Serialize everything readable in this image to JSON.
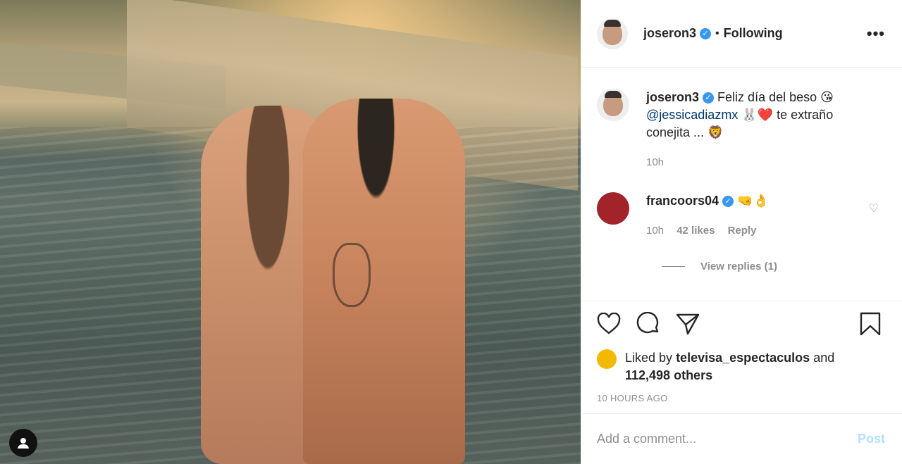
{
  "post": {
    "username": "joseron3",
    "separator": "•",
    "follow_status": "Following",
    "more_icon": "more-options-icon"
  },
  "caption": {
    "username": "joseron3",
    "text_part1": "Feliz día del beso 😘",
    "mention": "@jessicadiazmx",
    "text_part2": "🐰❤️ te extraño conejita ... 🦁",
    "time": "10h"
  },
  "comments": [
    {
      "username": "francoors04",
      "text": "🤜👌",
      "time": "10h",
      "likes": "42 likes",
      "reply_label": "Reply",
      "view_replies": "View replies (1)"
    }
  ],
  "likes": {
    "prefix": "Liked by",
    "user": "televisa_espectaculos",
    "joiner": "and",
    "others": "112,498 others",
    "ago": "10 HOURS AGO"
  },
  "add_comment": {
    "placeholder": "Add a comment...",
    "post_label": "Post"
  },
  "colors": {
    "verified": "#3897f0",
    "post_button": "#b2dffc",
    "mention": "#00376b"
  }
}
